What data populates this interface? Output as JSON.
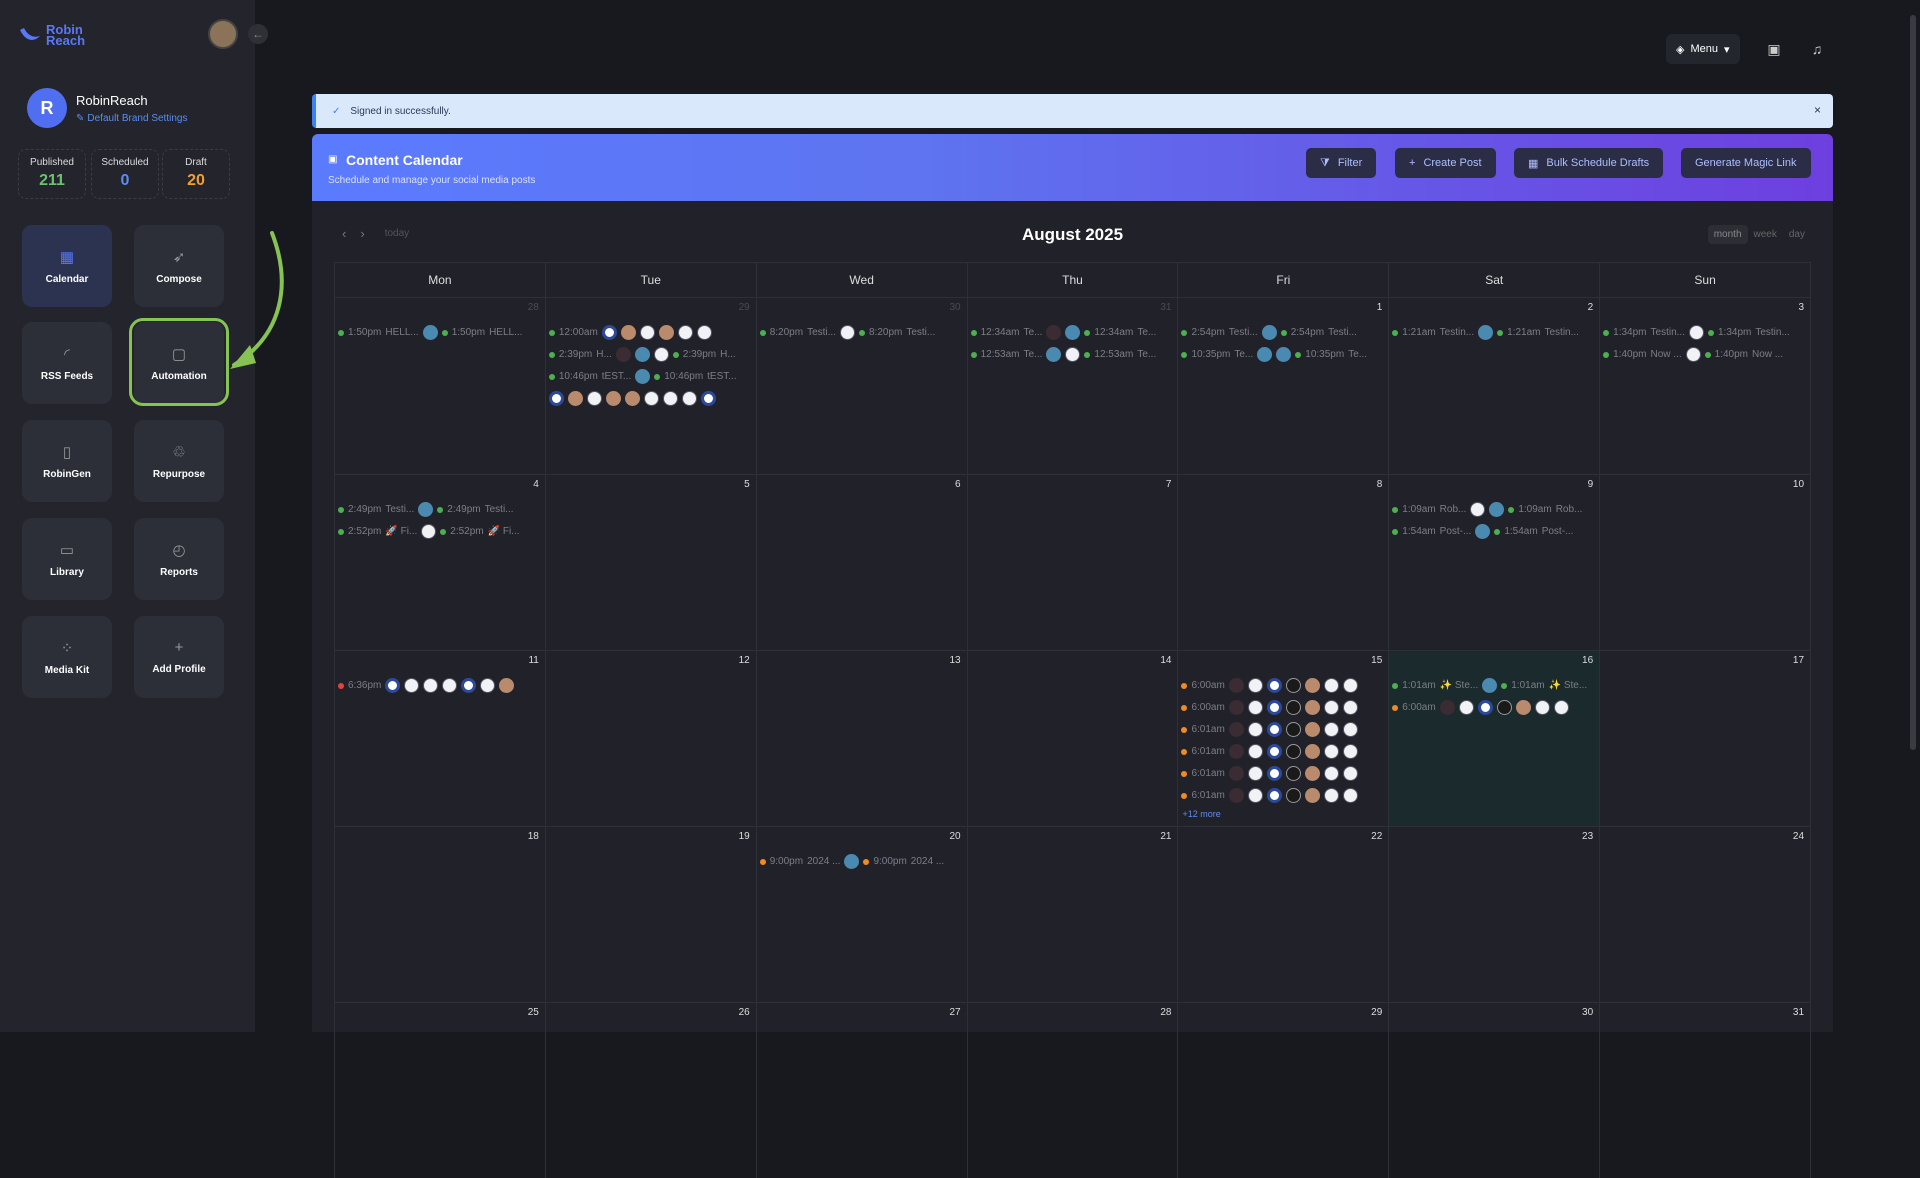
{
  "brand": {
    "logo_line1": "Robin",
    "logo_line2": "Reach"
  },
  "profile": {
    "initial": "R",
    "name": "RobinReach",
    "settings_link": "Default Brand Settings"
  },
  "stats": [
    {
      "label": "Published",
      "value": "211",
      "color": "#6bc46d"
    },
    {
      "label": "Scheduled",
      "value": "0",
      "color": "#5a8cf5"
    },
    {
      "label": "Draft",
      "value": "20",
      "color": "#f0a030"
    }
  ],
  "nav": [
    {
      "label": "Calendar",
      "icon": "calendar-icon",
      "active": true
    },
    {
      "label": "Compose",
      "icon": "rocket-icon"
    },
    {
      "label": "RSS Feeds",
      "icon": "rss-icon"
    },
    {
      "label": "Automation",
      "icon": "robot-icon"
    },
    {
      "label": "RobinGen",
      "icon": "file-icon"
    },
    {
      "label": "Repurpose",
      "icon": "recycle-icon"
    },
    {
      "label": "Library",
      "icon": "folder-icon"
    },
    {
      "label": "Reports",
      "icon": "chart-icon"
    },
    {
      "label": "Media Kit",
      "icon": "grid-icon"
    },
    {
      "label": "Add Profile",
      "icon": "plus-icon"
    }
  ],
  "topbar": {
    "menu_label": "Menu"
  },
  "alert": {
    "text": "Signed in successfully.",
    "close": "×"
  },
  "content_calendar": {
    "title": "Content Calendar",
    "subtitle": "Schedule and manage your social media posts",
    "buttons": {
      "filter": "Filter",
      "create_post": "Create Post",
      "bulk_schedule": "Bulk Schedule Drafts",
      "magic_link": "Generate Magic Link"
    }
  },
  "calendar": {
    "month_title": "August 2025",
    "today_label": "today",
    "views": [
      "month",
      "week",
      "day"
    ],
    "weekdays": [
      "Mon",
      "Tue",
      "Wed",
      "Thu",
      "Fri",
      "Sat",
      "Sun"
    ],
    "more_label": "+12 more",
    "weeks": [
      [
        "28",
        "29",
        "30",
        "31",
        "1",
        "2",
        "3"
      ],
      [
        "4",
        "5",
        "6",
        "7",
        "8",
        "9",
        "10"
      ],
      [
        "11",
        "12",
        "13",
        "14",
        "15",
        "16",
        "17"
      ],
      [
        "18",
        "19",
        "20",
        "21",
        "22",
        "23",
        "24"
      ],
      [
        "25",
        "26",
        "27",
        "28",
        "29",
        "30",
        "31"
      ]
    ],
    "events": {
      "w0": {
        "mon": [
          {
            "t1": "1:50pm",
            "x1": "HELL...",
            "t2": "1:50pm",
            "x2": "HELL..."
          }
        ],
        "tue": [
          {
            "t1": "12:00am"
          },
          {
            "t1": "2:39pm",
            "x1": "H...",
            "t2": "2:39pm",
            "x2": "H..."
          },
          {
            "t1": "10:46pm",
            "x1": "tEST...",
            "t2": "10:46pm",
            "x2": "tEST..."
          }
        ],
        "wed": [
          {
            "t1": "8:20pm",
            "x1": "Testi...",
            "t2": "8:20pm",
            "x2": "Testi..."
          }
        ],
        "thu": [
          {
            "t1": "12:34am",
            "x1": "Te...",
            "t2": "12:34am",
            "x2": "Te..."
          },
          {
            "t1": "12:53am",
            "x1": "Te...",
            "t2": "12:53am",
            "x2": "Te..."
          }
        ],
        "fri": [
          {
            "t1": "2:54pm",
            "x1": "Testi...",
            "t2": "2:54pm",
            "x2": "Testi..."
          },
          {
            "t1": "10:35pm",
            "x1": "Te...",
            "t2": "10:35pm",
            "x2": "Te..."
          }
        ],
        "sat": [
          {
            "t1": "1:21am",
            "x1": "Testin...",
            "t2": "1:21am",
            "x2": "Testin..."
          }
        ],
        "sun": [
          {
            "t1": "1:34pm",
            "x1": "Testin...",
            "t2": "1:34pm",
            "x2": "Testin..."
          },
          {
            "t1": "1:40pm",
            "x1": "Now ...",
            "t2": "1:40pm",
            "x2": "Now ..."
          }
        ]
      },
      "w1": {
        "mon": [
          {
            "t1": "2:49pm",
            "x1": "Testi...",
            "t2": "2:49pm",
            "x2": "Testi..."
          },
          {
            "t1": "2:52pm",
            "x1": "🚀 Fi...",
            "t2": "2:52pm",
            "x2": "🚀 Fi..."
          }
        ],
        "sat": [
          {
            "t1": "1:09am",
            "x1": "Rob...",
            "t2": "1:09am",
            "x2": "Rob..."
          },
          {
            "t1": "1:54am",
            "x1": "Post-...",
            "t2": "1:54am",
            "x2": "Post-..."
          }
        ]
      },
      "w2": {
        "mon": [
          {
            "t1": "6:36pm"
          }
        ],
        "fri": [
          {
            "t1": "6:00am"
          },
          {
            "t1": "6:00am"
          },
          {
            "t1": "6:01am"
          },
          {
            "t1": "6:01am"
          },
          {
            "t1": "6:01am"
          },
          {
            "t1": "6:01am"
          }
        ],
        "sat": [
          {
            "t1": "1:01am",
            "x1": "✨ Ste...",
            "t2": "1:01am",
            "x2": "✨ Ste..."
          },
          {
            "t1": "6:00am"
          }
        ]
      },
      "w3": {
        "wed": [
          {
            "t1": "9:00pm",
            "x1": "2024 ...",
            "t2": "9:00pm",
            "x2": "2024 ..."
          }
        ]
      }
    }
  }
}
